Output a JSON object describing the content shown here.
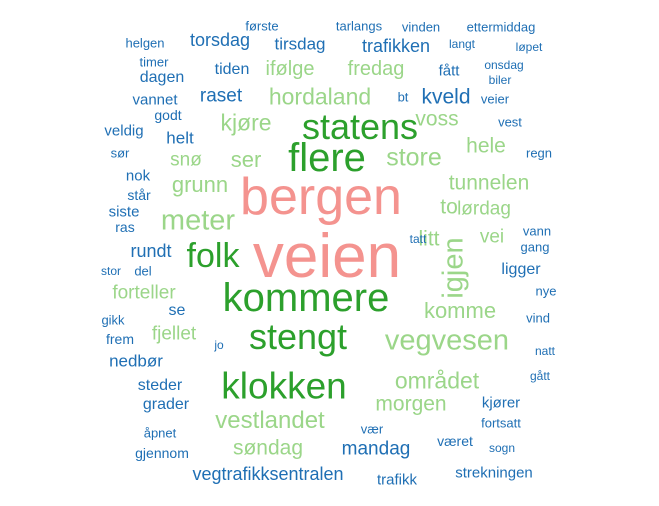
{
  "colors": {
    "pink": "#f4938f",
    "dark_green": "#2ca02c",
    "light_green": "#9bd689",
    "blue": "#1f6fb4"
  },
  "words": [
    {
      "text": "veien",
      "color": "pink"
    },
    {
      "text": "bergen",
      "color": "pink"
    },
    {
      "text": "kommere",
      "color": "dark_green"
    },
    {
      "text": "flere",
      "color": "dark_green"
    },
    {
      "text": "statens",
      "color": "dark_green"
    },
    {
      "text": "stengt",
      "color": "dark_green"
    },
    {
      "text": "klokken",
      "color": "dark_green"
    },
    {
      "text": "folk",
      "color": "dark_green"
    },
    {
      "text": "vegvesen",
      "color": "light_green"
    },
    {
      "text": "meter",
      "color": "light_green"
    },
    {
      "text": "igjen",
      "color": "light_green"
    },
    {
      "text": "hordaland",
      "color": "light_green"
    },
    {
      "text": "store",
      "color": "light_green"
    },
    {
      "text": "området",
      "color": "light_green"
    },
    {
      "text": "vestlandet",
      "color": "light_green"
    },
    {
      "text": "komme",
      "color": "light_green"
    },
    {
      "text": "morgen",
      "color": "light_green"
    },
    {
      "text": "tunnelen",
      "color": "light_green"
    },
    {
      "text": "grunn",
      "color": "light_green"
    },
    {
      "text": "fredag",
      "color": "light_green"
    },
    {
      "text": "ifølge",
      "color": "light_green"
    },
    {
      "text": "kjøre",
      "color": "light_green"
    },
    {
      "text": "ser",
      "color": "light_green"
    },
    {
      "text": "snø",
      "color": "light_green"
    },
    {
      "text": "voss",
      "color": "light_green"
    },
    {
      "text": "hele",
      "color": "light_green"
    },
    {
      "text": "lørdag",
      "color": "light_green"
    },
    {
      "text": "to",
      "color": "light_green"
    },
    {
      "text": "litt",
      "color": "light_green"
    },
    {
      "text": "vei",
      "color": "light_green"
    },
    {
      "text": "forteller",
      "color": "light_green"
    },
    {
      "text": "fjellet",
      "color": "light_green"
    },
    {
      "text": "søndag",
      "color": "light_green"
    },
    {
      "text": "kveld",
      "color": "blue"
    },
    {
      "text": "mandag",
      "color": "blue"
    },
    {
      "text": "vegtrafikksentralen",
      "color": "blue"
    },
    {
      "text": "trafikken",
      "color": "blue"
    },
    {
      "text": "tirsdag",
      "color": "blue"
    },
    {
      "text": "torsdag",
      "color": "blue"
    },
    {
      "text": "raset",
      "color": "blue"
    },
    {
      "text": "tiden",
      "color": "blue"
    },
    {
      "text": "rundt",
      "color": "blue"
    },
    {
      "text": "helt",
      "color": "blue"
    },
    {
      "text": "dagen",
      "color": "blue"
    },
    {
      "text": "vannet",
      "color": "blue"
    },
    {
      "text": "nedbør",
      "color": "blue"
    },
    {
      "text": "steder",
      "color": "blue"
    },
    {
      "text": "grader",
      "color": "blue"
    },
    {
      "text": "se",
      "color": "blue"
    },
    {
      "text": "ligger",
      "color": "blue"
    },
    {
      "text": "strekningen",
      "color": "blue"
    },
    {
      "text": "kjører",
      "color": "blue"
    },
    {
      "text": "været",
      "color": "blue"
    },
    {
      "text": "fått",
      "color": "blue"
    },
    {
      "text": "bt",
      "color": "blue"
    },
    {
      "text": "første",
      "color": "blue"
    },
    {
      "text": "tarlangs",
      "color": "blue"
    },
    {
      "text": "vinden",
      "color": "blue"
    },
    {
      "text": "ettermiddag",
      "color": "blue"
    },
    {
      "text": "helgen",
      "color": "blue"
    },
    {
      "text": "langt",
      "color": "blue"
    },
    {
      "text": "løpet",
      "color": "blue"
    },
    {
      "text": "timer",
      "color": "blue"
    },
    {
      "text": "onsdag",
      "color": "blue"
    },
    {
      "text": "biler",
      "color": "blue"
    },
    {
      "text": "veier",
      "color": "blue"
    },
    {
      "text": "godt",
      "color": "blue"
    },
    {
      "text": "veldig",
      "color": "blue"
    },
    {
      "text": "vest",
      "color": "blue"
    },
    {
      "text": "sør",
      "color": "blue"
    },
    {
      "text": "regn",
      "color": "blue"
    },
    {
      "text": "nok",
      "color": "blue"
    },
    {
      "text": "står",
      "color": "blue"
    },
    {
      "text": "siste",
      "color": "blue"
    },
    {
      "text": "ras",
      "color": "blue"
    },
    {
      "text": "tatt",
      "color": "blue"
    },
    {
      "text": "vann",
      "color": "blue"
    },
    {
      "text": "gang",
      "color": "blue"
    },
    {
      "text": "stor",
      "color": "blue"
    },
    {
      "text": "del",
      "color": "blue"
    },
    {
      "text": "nye",
      "color": "blue"
    },
    {
      "text": "gikk",
      "color": "blue"
    },
    {
      "text": "vind",
      "color": "blue"
    },
    {
      "text": "frem",
      "color": "blue"
    },
    {
      "text": "jo",
      "color": "blue"
    },
    {
      "text": "natt",
      "color": "blue"
    },
    {
      "text": "gått",
      "color": "blue"
    },
    {
      "text": "vær",
      "color": "blue"
    },
    {
      "text": "fortsatt",
      "color": "blue"
    },
    {
      "text": "åpnet",
      "color": "blue"
    },
    {
      "text": "gjennom",
      "color": "blue"
    },
    {
      "text": "sogn",
      "color": "blue"
    },
    {
      "text": "trafikk",
      "color": "blue"
    }
  ]
}
